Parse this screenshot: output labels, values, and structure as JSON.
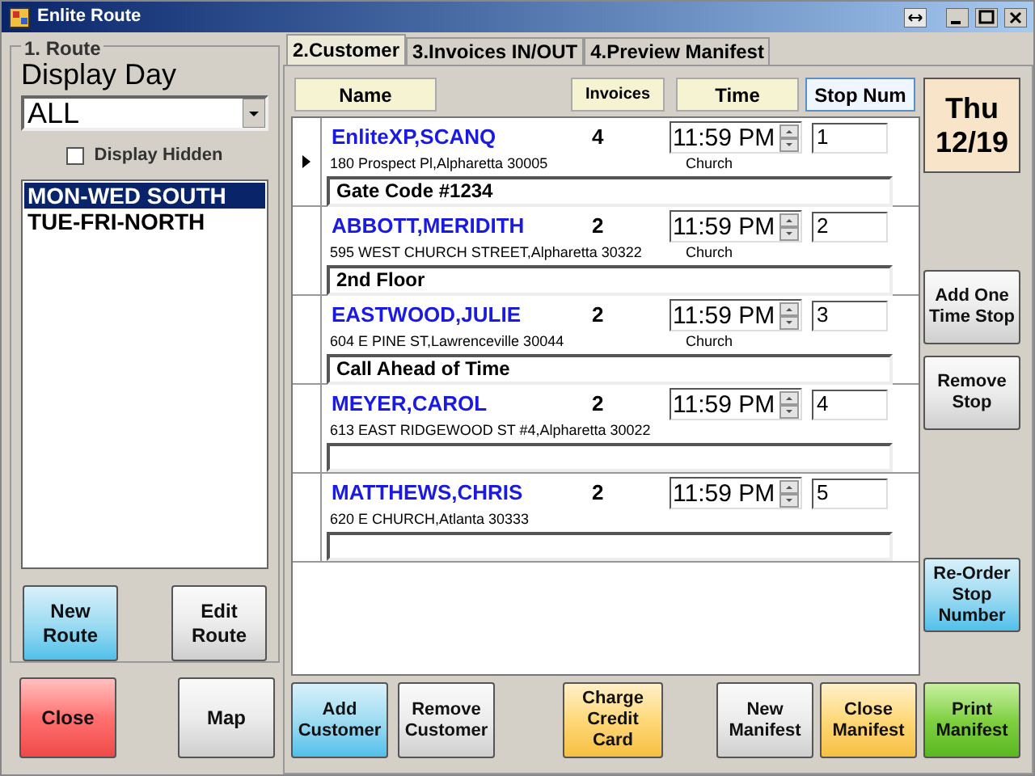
{
  "window": {
    "title": "Enlite Route"
  },
  "route_group": {
    "legend": "1. Route",
    "display_day_label": "Display Day",
    "display_day": "ALL",
    "display_hidden": {
      "label": "Display Hidden",
      "checked": false
    },
    "routes": [
      {
        "label": "MON-WED SOUTH",
        "selected": true
      },
      {
        "label": "TUE-FRI-NORTH",
        "selected": false
      }
    ],
    "buttons": [
      {
        "label": "New Route",
        "kind": "blue"
      },
      {
        "label": "Edit Route",
        "kind": "gray"
      }
    ]
  },
  "left_buttons": [
    {
      "label": "Close",
      "kind": "red"
    },
    {
      "label": "Map",
      "kind": "gray"
    }
  ],
  "tabs": [
    {
      "label": "2.Customer",
      "selected": true
    },
    {
      "label": "3.Invoices IN/OUT",
      "selected": false
    },
    {
      "label": "4.Preview Manifest",
      "selected": false
    }
  ],
  "headers": {
    "name": "Name",
    "invoices": "Invoices",
    "time": "Time",
    "stop": "Stop Num"
  },
  "date": {
    "day": "Thu",
    "date": "12/19"
  },
  "stops": [
    {
      "name": "EnliteXP,SCANQ",
      "invoices": "4",
      "time": "11:59 PM",
      "stop": "1",
      "address": "180 Prospect Pl,Alpharetta 30005",
      "location": "Church",
      "note": "Gate Code #1234",
      "selected": true
    },
    {
      "name": "ABBOTT,MERIDITH",
      "invoices": "2",
      "time": "11:59 PM",
      "stop": "2",
      "address": "595 WEST CHURCH STREET,Alpharetta 30322",
      "location": "Church",
      "note": "2nd Floor",
      "selected": false
    },
    {
      "name": "EASTWOOD,JULIE",
      "invoices": "2",
      "time": "11:59 PM",
      "stop": "3",
      "address": "604 E PINE ST,Lawrenceville 30044",
      "location": "Church",
      "note": "Call Ahead of Time",
      "selected": false
    },
    {
      "name": "MEYER,CAROL",
      "invoices": "2",
      "time": "11:59 PM",
      "stop": "4",
      "address": "613 EAST RIDGEWOOD ST #4,Alpharetta 30022",
      "selected": false
    },
    {
      "name": "MATTHEWS,CHRIS",
      "invoices": "2",
      "time": "11:59 PM",
      "stop": "5",
      "address": "620 E CHURCH,Atlanta 30333",
      "selected": false
    }
  ],
  "side_buttons": [
    {
      "label": "Add One Time Stop",
      "kind": "gray"
    },
    {
      "label": "Remove Stop",
      "kind": "gray"
    },
    {
      "label": "Re-Order Stop Number",
      "kind": "blue"
    }
  ],
  "bottom_buttons": [
    {
      "label": "Add Customer",
      "kind": "blue"
    },
    {
      "label": "Remove Customer",
      "kind": "gray"
    },
    {
      "label": "Charge Credit Card",
      "kind": "orange"
    },
    {
      "label": "New Manifest",
      "kind": "gray"
    },
    {
      "label": "Close Manifest",
      "kind": "orange"
    },
    {
      "label": "Print Manifest",
      "kind": "green"
    }
  ]
}
